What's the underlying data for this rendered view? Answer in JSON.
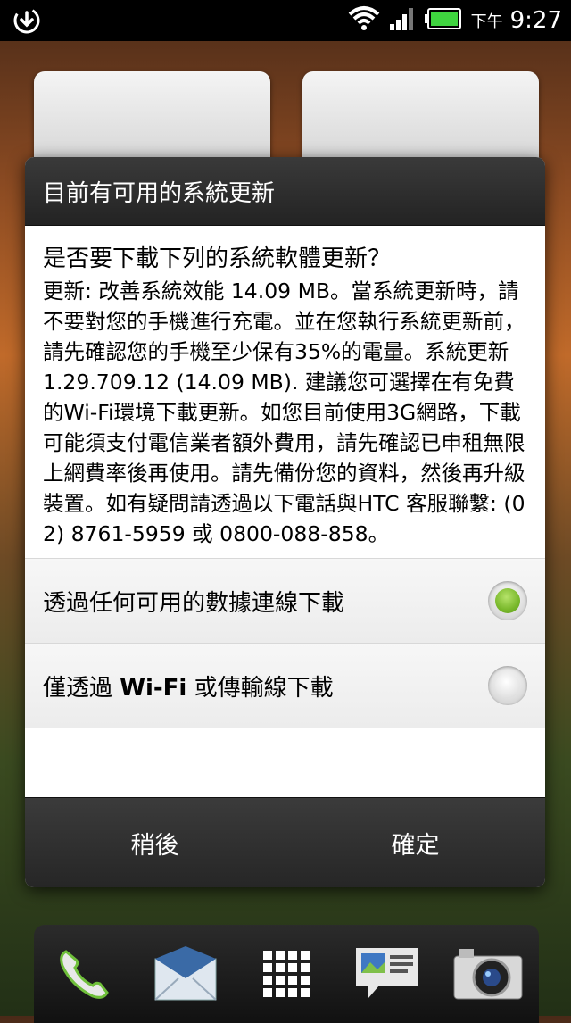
{
  "status_bar": {
    "icons": [
      "download-icon",
      "wifi-icon",
      "signal-icon",
      "battery-icon"
    ],
    "ampm": "下午",
    "time": "9:27"
  },
  "dialog": {
    "title": "目前有可用的系統更新",
    "question": "是否要下載下列的系統軟體更新？",
    "message": "更新: 改善系統效能 14.09 MB。當系統更新時，請不要對您的手機進行充電。並在您執行系統更新前，請先確認您的手機至少保有35%的電量。系統更新1.29.709.12 (14.09 MB). 建議您可選擇在有免費的Wi-Fi環境下載更新。如您目前使用3G網路，下載可能須支付電信業者額外費用，請先確認已申租無限上網費率後再使用。請先備份您的資料，然後再升級裝置。如有疑問請透過以下電話與HTC 客服聯繫: (02) 8761-5959 或 0800-088-858。",
    "options": [
      {
        "label_pre": "透過任何可用的數據連線下載",
        "label_bold": "",
        "label_post": "",
        "selected": true
      },
      {
        "label_pre": "僅透過 ",
        "label_bold": "Wi-Fi",
        "label_post": " 或傳輸線下載",
        "selected": false
      }
    ],
    "buttons": {
      "later": "稍後",
      "confirm": "確定"
    }
  },
  "dock": {
    "items": [
      "phone-icon",
      "mail-icon",
      "apps-icon",
      "messages-icon",
      "camera-icon"
    ]
  },
  "colors": {
    "accent_green": "#79b82b"
  }
}
